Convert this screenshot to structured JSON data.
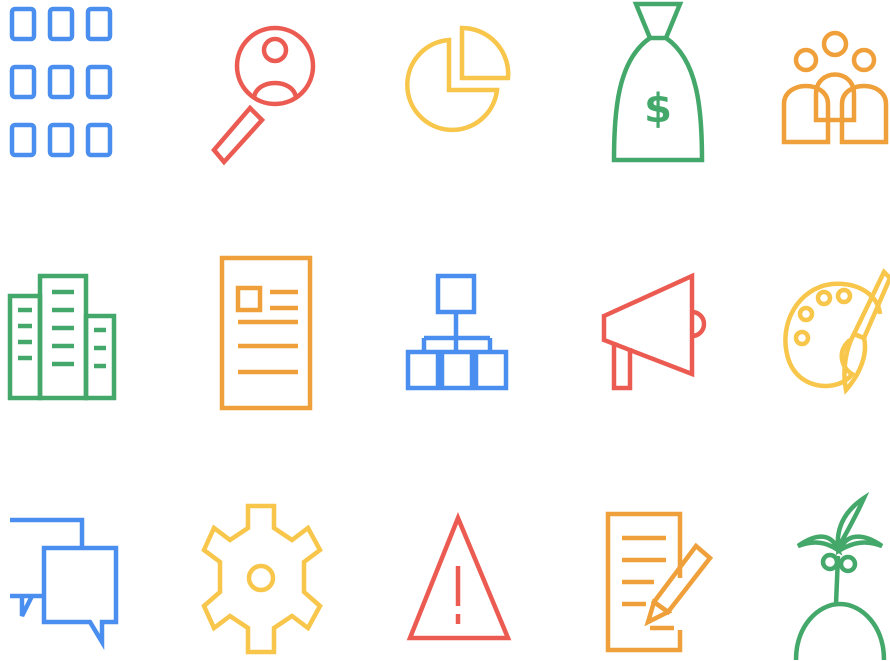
{
  "colors": {
    "blue": "#4a8ff0",
    "red": "#ec5b52",
    "yellow": "#f7c64a",
    "green": "#43a86a",
    "orange": "#efa03a"
  },
  "icons": [
    {
      "name": "app-grid-icon",
      "color": "blue"
    },
    {
      "name": "user-search-icon",
      "color": "red"
    },
    {
      "name": "pie-chart-icon",
      "color": "yellow"
    },
    {
      "name": "money-bag-icon",
      "color": "green",
      "label": "$"
    },
    {
      "name": "team-icon",
      "color": "orange"
    },
    {
      "name": "buildings-icon",
      "color": "green"
    },
    {
      "name": "document-icon",
      "color": "orange"
    },
    {
      "name": "org-chart-icon",
      "color": "blue"
    },
    {
      "name": "megaphone-icon",
      "color": "red"
    },
    {
      "name": "paint-palette-icon",
      "color": "yellow"
    },
    {
      "name": "chat-bubbles-icon",
      "color": "blue"
    },
    {
      "name": "gear-icon",
      "color": "yellow"
    },
    {
      "name": "warning-icon",
      "color": "red"
    },
    {
      "name": "edit-document-icon",
      "color": "orange"
    },
    {
      "name": "palm-island-icon",
      "color": "green"
    }
  ]
}
